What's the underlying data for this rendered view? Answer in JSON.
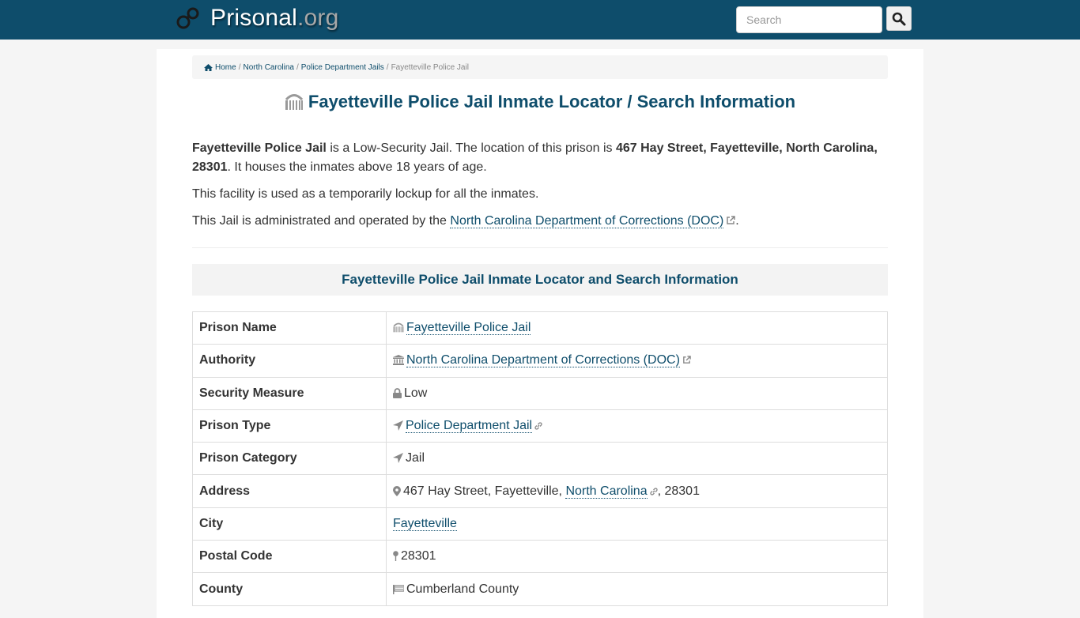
{
  "header": {
    "brand_name": "Prisonal",
    "brand_tld": ".org",
    "search_placeholder": "Search",
    "search_value": ""
  },
  "breadcrumb": {
    "items": [
      {
        "label": "Home",
        "icon": "home-icon"
      },
      {
        "label": "North Carolina"
      },
      {
        "label": "Police Department Jails"
      },
      {
        "label": "Fayetteville Police Jail",
        "active": true
      }
    ]
  },
  "page": {
    "title": "Fayetteville Police Jail Inmate Locator / Search Information",
    "title_icon": "prison-building-icon"
  },
  "intro": {
    "p1_name": "Fayetteville Police Jail",
    "p1_mid": " is a Low-Security Jail. The location of this prison is ",
    "p1_address": "467 Hay Street, Fayetteville, North Carolina, 28301",
    "p1_end": ". It houses the inmates above 18 years of age.",
    "p2": "This facility is used as a temporarily lockup for all the inmates.",
    "p3_pre": "This Jail is administrated and operated by the ",
    "p3_link": "North Carolina Department of Corrections (DOC)",
    "p3_end": "."
  },
  "section": {
    "heading": "Fayetteville Police Jail Inmate Locator and Search Information"
  },
  "details": {
    "rows": [
      {
        "label": "Prison Name",
        "value": "Fayetteville Police Jail",
        "icon": "prison-building-icon"
      },
      {
        "label": "Authority",
        "value": "North Carolina Department of Corrections (DOC)",
        "icon": "institution-icon"
      },
      {
        "label": "Security Measure",
        "value": "Low",
        "icon": "lock-icon"
      },
      {
        "label": "Prison Type",
        "value": "Police Department Jail",
        "icon": "location-arrow-icon"
      },
      {
        "label": "Prison Category",
        "value": "Jail",
        "icon": "location-arrow-icon"
      },
      {
        "label": "Address",
        "value_pre": "467 Hay Street, Fayetteville, ",
        "value_link": "North Carolina",
        "value_post": ", 28301",
        "icon": "map-marker-icon"
      },
      {
        "label": "City",
        "value": "Fayetteville"
      },
      {
        "label": "Postal Code",
        "value": "28301",
        "icon": "map-pin-icon"
      },
      {
        "label": "County",
        "value": "Cumberland County",
        "icon": "flag-icon"
      }
    ]
  },
  "colors": {
    "header_bg": "#0e4d6b",
    "link": "#0e4d6b",
    "text": "#333333",
    "icon_gray": "#888888"
  }
}
